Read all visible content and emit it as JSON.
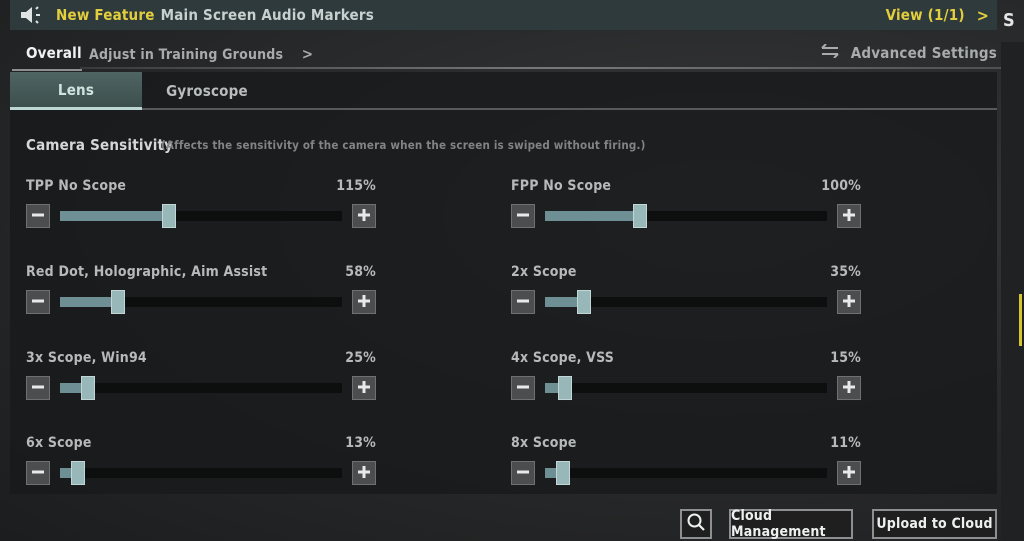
{
  "banner": {
    "icon": "speaker-icon",
    "highlight": "New Feature",
    "title": "Main Screen Audio Markers",
    "view_label": "View (1/1)",
    "view_chevron": ">"
  },
  "edge_letter": "S",
  "subtabs": {
    "overall": "Overall",
    "adjust": "Adjust in Training Grounds",
    "adjust_chevron": ">",
    "advanced_icon": "swap-arrows-icon",
    "advanced": "Advanced Settings"
  },
  "tabs": [
    {
      "label": "Lens",
      "active": true
    },
    {
      "label": "Gyroscope",
      "active": false
    }
  ],
  "section": {
    "title": "Camera Sensitivity",
    "note": "(Affects the sensitivity of the camera when the screen is swiped without firing.)"
  },
  "sliders": [
    {
      "label": "TPP No Scope",
      "value": "115%",
      "fraction": 0.38
    },
    {
      "label": "FPP No Scope",
      "value": "100%",
      "fraction": 0.33
    },
    {
      "label": "Red Dot, Holographic, Aim Assist",
      "value": "58%",
      "fraction": 0.19
    },
    {
      "label": "2x Scope",
      "value": "35%",
      "fraction": 0.12
    },
    {
      "label": "3x Scope, Win94",
      "value": "25%",
      "fraction": 0.08
    },
    {
      "label": "4x Scope, VSS",
      "value": "15%",
      "fraction": 0.05
    },
    {
      "label": "6x Scope",
      "value": "13%",
      "fraction": 0.04
    },
    {
      "label": "8x Scope",
      "value": "11%",
      "fraction": 0.04
    }
  ],
  "buttons": {
    "search_icon": "search-icon",
    "cloud_management": "Cloud Management",
    "upload_to_cloud": "Upload to Cloud"
  },
  "colors": {
    "accent_yellow": "#e3cf3d",
    "slider_fill": "#6e9094",
    "slider_thumb": "#97b7b9",
    "tab_active": "#4f6563"
  }
}
